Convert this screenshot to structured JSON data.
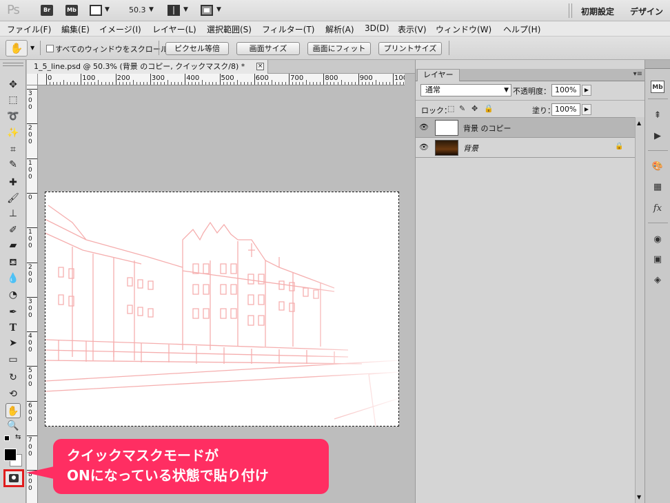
{
  "appbar": {
    "logo": "Ps",
    "bridge_icon": "Br",
    "minibridge_icon": "Mb",
    "zoom_value": "50.3",
    "workspace_default": "初期設定",
    "workspace_design": "デザイン"
  },
  "menu": {
    "items": [
      "ファイル(F)",
      "編集(E)",
      "イメージ(I)",
      "レイヤー(L)",
      "選択範囲(S)",
      "フィルター(T)",
      "解析(A)",
      "3D(D)",
      "表示(V)",
      "ウィンドウ(W)",
      "ヘルプ(H)"
    ]
  },
  "options": {
    "scroll_all_label": "すべてのウィンドウをスクロール",
    "scroll_all_checked": false,
    "actual_pixels": "ピクセル等倍",
    "fit_screen": "画面サイズ",
    "fill_screen": "画面にフィット",
    "print_size": "プリントサイズ"
  },
  "document": {
    "tab_title": "1_5_line.psd @ 50.3% (背景 のコピー, クイックマスク/8) *",
    "close_symbol": "×"
  },
  "ruler_h_labels": [
    "0",
    "100",
    "200",
    "300",
    "400",
    "500",
    "600",
    "700",
    "800",
    "900",
    "1000"
  ],
  "ruler_v_labels": [
    "300",
    "200",
    "100",
    "0",
    "100",
    "200",
    "300",
    "400",
    "500",
    "600",
    "700",
    "800"
  ],
  "callout": {
    "line1": "クイックマスクモードが",
    "line2": "ONになっている状態で貼り付け"
  },
  "layers": {
    "tab_label": "レイヤー",
    "blend_mode": "通常",
    "opacity_label": "不透明度：",
    "opacity_value": "100%",
    "lock_label": "ロック：",
    "fill_label": "塗り：",
    "fill_value": "100%",
    "items": [
      {
        "name": "背景 のコピー",
        "selected": true,
        "locked": false
      },
      {
        "name": "背景",
        "selected": false,
        "locked": true
      }
    ]
  },
  "colors": {
    "callout": "#ff2e62",
    "highlight_border": "#e01c1c",
    "mask_tint": "#f4a0a0"
  }
}
